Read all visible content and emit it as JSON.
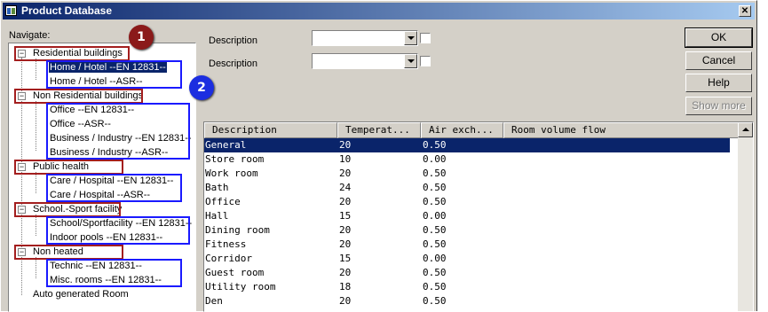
{
  "window": {
    "title": "Product Database",
    "close_label": "✕"
  },
  "navigate_label": "Navigate:",
  "tree": {
    "groups": [
      {
        "label": "Residential buildings",
        "items": [
          "Home / Hotel --EN 12831--",
          "Home / Hotel --ASR--"
        ]
      },
      {
        "label": "Non Residential buildings",
        "items": [
          "Office --EN 12831--",
          "Office --ASR--",
          "Business / Industry --EN 12831--",
          "Business / Industry --ASR--"
        ]
      },
      {
        "label": "Public health",
        "items": [
          "Care / Hospital --EN 12831--",
          "Care / Hospital --ASR--"
        ]
      },
      {
        "label": "School.-Sport facility",
        "items": [
          "School/Sportfacility --EN 12831--",
          "Indoor pools --EN 12831--"
        ]
      },
      {
        "label": "Non heated",
        "items": [
          "Technic --EN 12831--",
          "Misc. rooms --EN 12831--"
        ]
      }
    ],
    "extra_item": "Auto generated Room"
  },
  "badges": {
    "first": "1",
    "second": "2"
  },
  "filters": [
    {
      "label": "Description",
      "value": ""
    },
    {
      "label": "Description",
      "value": ""
    }
  ],
  "buttons": {
    "ok": "OK",
    "cancel": "Cancel",
    "help": "Help",
    "show_more": "Show more"
  },
  "table": {
    "columns": [
      "Description",
      "Temperat...",
      "Air exch...",
      "Room volume flow"
    ],
    "rows": [
      [
        "General",
        "20",
        "0.50",
        ""
      ],
      [
        "Store room",
        "10",
        "0.00",
        ""
      ],
      [
        "Work room",
        "20",
        "0.50",
        ""
      ],
      [
        "Bath",
        "24",
        "0.50",
        ""
      ],
      [
        "Office",
        "20",
        "0.50",
        ""
      ],
      [
        "Hall",
        "15",
        "0.00",
        ""
      ],
      [
        "Dining room",
        "20",
        "0.50",
        ""
      ],
      [
        "Fitness",
        "20",
        "0.50",
        ""
      ],
      [
        "Corridor",
        "15",
        "0.00",
        ""
      ],
      [
        "Guest room",
        "20",
        "0.50",
        ""
      ],
      [
        "Utility room",
        "18",
        "0.50",
        ""
      ],
      [
        "Den",
        "20",
        "0.50",
        ""
      ]
    ]
  },
  "colors": {
    "selection": "#0a246a",
    "annotation_red": "#a31e1e",
    "annotation_blue": "#1a1aff"
  }
}
